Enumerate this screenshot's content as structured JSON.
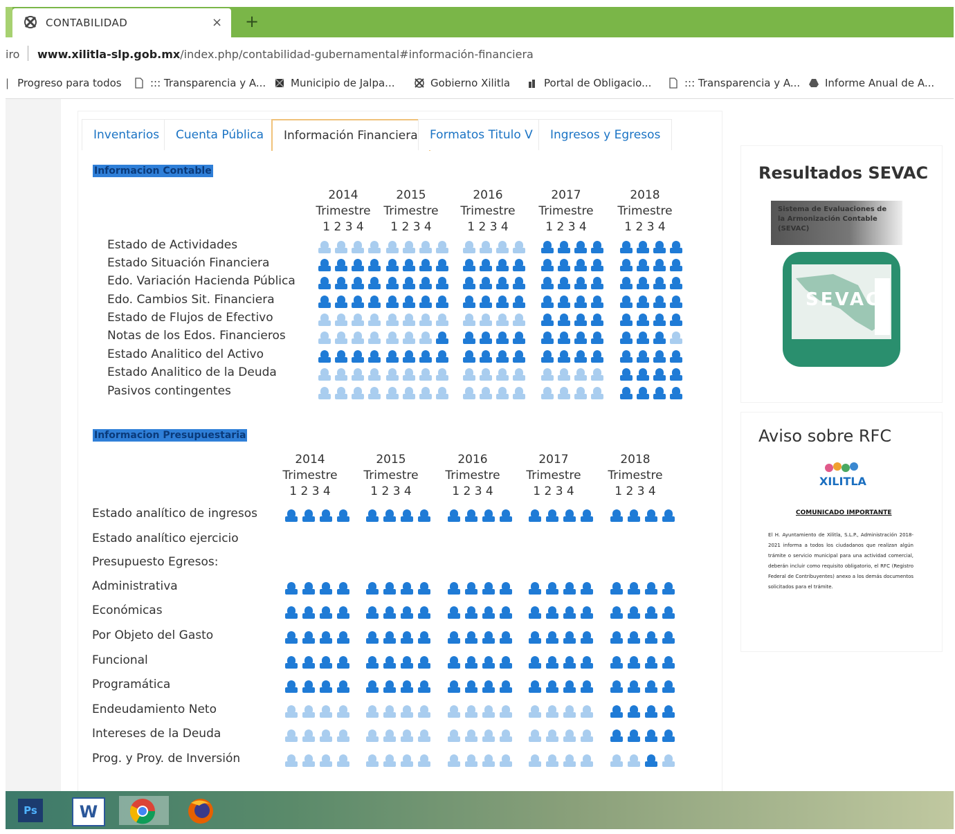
{
  "browser": {
    "tab_title": "CONTABILIDAD",
    "tab_close": "×",
    "new_tab": "+",
    "address_prefix": "iro",
    "url_host": "www.xilitla-slp.gob.mx",
    "url_path": "/index.php/contabilidad-gubernamental#información-financiera",
    "bookmarks": [
      {
        "label": "Progreso para todos",
        "icon": "none"
      },
      {
        "label": "::: Transparencia y A...",
        "icon": "page-icon"
      },
      {
        "label": "Municipio de Jalpa...",
        "icon": "seal-icon"
      },
      {
        "label": "Gobierno Xilitla",
        "icon": "seal-icon"
      },
      {
        "label": "Portal de Obligacio...",
        "icon": "portal-icon"
      },
      {
        "label": "::: Transparencia y A...",
        "icon": "page-icon"
      },
      {
        "label": "Informe Anual de A...",
        "icon": "drive-icon"
      }
    ]
  },
  "tabs": [
    "Inventarios",
    "Cuenta Pública",
    "Información Financiera",
    "Formatos Titulo V",
    "Ingresos y Egresos"
  ],
  "active_tab": "Información Financiera",
  "colors": {
    "icon_dark": "#1f7bd6",
    "icon_light": "#a9cdef",
    "accent": "#1a73c4"
  },
  "contable": {
    "title": "Informacion Contable",
    "years": [
      "2014",
      "2015",
      "2016",
      "2017",
      "2018"
    ],
    "trimestre_label": "Trimestre",
    "quarters": "1 2 3 4",
    "rows": [
      {
        "label": "Estado de Actividades",
        "status": [
          [
            0,
            0,
            0,
            0
          ],
          [
            0,
            0,
            0,
            0
          ],
          [
            0,
            0,
            0,
            0
          ],
          [
            1,
            1,
            1,
            1
          ],
          [
            1,
            1,
            1,
            1
          ]
        ]
      },
      {
        "label": "Estado Situación Financiera",
        "status": [
          [
            1,
            1,
            1,
            1
          ],
          [
            1,
            1,
            1,
            1
          ],
          [
            1,
            1,
            1,
            1
          ],
          [
            1,
            1,
            1,
            1
          ],
          [
            1,
            1,
            1,
            1
          ]
        ]
      },
      {
        "label": "Edo. Variación Hacienda Pública",
        "status": [
          [
            1,
            1,
            1,
            1
          ],
          [
            1,
            1,
            1,
            1
          ],
          [
            1,
            1,
            1,
            1
          ],
          [
            1,
            1,
            1,
            1
          ],
          [
            1,
            1,
            1,
            1
          ]
        ]
      },
      {
        "label": "Edo. Cambios Sit. Financiera",
        "status": [
          [
            1,
            1,
            1,
            1
          ],
          [
            1,
            1,
            1,
            1
          ],
          [
            1,
            1,
            1,
            1
          ],
          [
            1,
            1,
            1,
            1
          ],
          [
            1,
            1,
            1,
            1
          ]
        ]
      },
      {
        "label": "Estado de Flujos de Efectivo",
        "status": [
          [
            0,
            0,
            0,
            0
          ],
          [
            0,
            0,
            0,
            0
          ],
          [
            0,
            0,
            0,
            0
          ],
          [
            1,
            1,
            1,
            1
          ],
          [
            1,
            1,
            1,
            1
          ]
        ]
      },
      {
        "label": "Notas de los Edos. Financieros",
        "status": [
          [
            0,
            0,
            0,
            0
          ],
          [
            0,
            0,
            0,
            1
          ],
          [
            1,
            1,
            1,
            1
          ],
          [
            1,
            1,
            1,
            1
          ],
          [
            1,
            1,
            1,
            0
          ]
        ]
      },
      {
        "label": "Estado Analitico del Activo",
        "status": [
          [
            1,
            1,
            1,
            1
          ],
          [
            1,
            1,
            1,
            1
          ],
          [
            1,
            1,
            1,
            1
          ],
          [
            1,
            1,
            1,
            1
          ],
          [
            1,
            1,
            1,
            1
          ]
        ]
      },
      {
        "label": "Estado Analitico de la Deuda",
        "status": [
          [
            0,
            0,
            0,
            0
          ],
          [
            0,
            0,
            0,
            0
          ],
          [
            0,
            0,
            0,
            0
          ],
          [
            0,
            0,
            0,
            0
          ],
          [
            1,
            1,
            1,
            1
          ]
        ]
      },
      {
        "label": "Pasivos contingentes",
        "status": [
          [
            0,
            0,
            0,
            0
          ],
          [
            0,
            0,
            0,
            0
          ],
          [
            0,
            0,
            0,
            0
          ],
          [
            0,
            0,
            0,
            0
          ],
          [
            1,
            1,
            1,
            1
          ]
        ]
      }
    ]
  },
  "presupuestaria": {
    "title": "Informacion Presupuestaria",
    "years": [
      "2014",
      "2015",
      "2016",
      "2017",
      "2018"
    ],
    "trimestre_label": "Trimestre",
    "quarters": "1 2 3 4",
    "rows": [
      {
        "label": "Estado analítico de ingresos",
        "status": [
          [
            1,
            1,
            1,
            1
          ],
          [
            1,
            1,
            1,
            1
          ],
          [
            1,
            1,
            1,
            1
          ],
          [
            1,
            1,
            1,
            1
          ],
          [
            1,
            1,
            1,
            1
          ]
        ]
      },
      {
        "label": "Estado analítico ejercicio",
        "status": null
      },
      {
        "label": "Presupuesto Egresos:",
        "status": null
      },
      {
        "label": "Administrativa",
        "status": [
          [
            1,
            1,
            1,
            1
          ],
          [
            1,
            1,
            1,
            1
          ],
          [
            1,
            1,
            1,
            1
          ],
          [
            1,
            1,
            1,
            1
          ],
          [
            1,
            1,
            1,
            1
          ]
        ]
      },
      {
        "label": "Económicas",
        "status": [
          [
            1,
            1,
            1,
            1
          ],
          [
            1,
            1,
            1,
            1
          ],
          [
            1,
            1,
            1,
            1
          ],
          [
            1,
            1,
            1,
            1
          ],
          [
            1,
            1,
            1,
            1
          ]
        ]
      },
      {
        "label": "Por Objeto del Gasto",
        "status": [
          [
            1,
            1,
            1,
            1
          ],
          [
            1,
            1,
            1,
            1
          ],
          [
            1,
            1,
            1,
            1
          ],
          [
            1,
            1,
            1,
            1
          ],
          [
            1,
            1,
            1,
            1
          ]
        ]
      },
      {
        "label": "Funcional",
        "status": [
          [
            1,
            1,
            1,
            1
          ],
          [
            1,
            1,
            1,
            1
          ],
          [
            1,
            1,
            1,
            1
          ],
          [
            1,
            1,
            1,
            1
          ],
          [
            1,
            1,
            1,
            1
          ]
        ]
      },
      {
        "label": "Programática",
        "status": [
          [
            1,
            1,
            1,
            1
          ],
          [
            1,
            1,
            1,
            1
          ],
          [
            1,
            1,
            1,
            1
          ],
          [
            1,
            1,
            1,
            1
          ],
          [
            1,
            1,
            1,
            1
          ]
        ]
      },
      {
        "label": "Endeudamiento Neto",
        "status": [
          [
            0,
            0,
            0,
            0
          ],
          [
            0,
            0,
            0,
            0
          ],
          [
            0,
            0,
            0,
            0
          ],
          [
            0,
            0,
            0,
            0
          ],
          [
            1,
            1,
            1,
            1
          ]
        ]
      },
      {
        "label": "Intereses de la Deuda",
        "status": [
          [
            0,
            0,
            0,
            0
          ],
          [
            0,
            0,
            0,
            0
          ],
          [
            0,
            0,
            0,
            0
          ],
          [
            0,
            0,
            0,
            0
          ],
          [
            1,
            1,
            1,
            1
          ]
        ]
      },
      {
        "label": "Prog. y Proy. de Inversión",
        "status": [
          [
            0,
            0,
            0,
            0
          ],
          [
            0,
            0,
            0,
            0
          ],
          [
            0,
            0,
            0,
            0
          ],
          [
            0,
            0,
            0,
            0
          ],
          [
            0,
            0,
            1,
            0
          ]
        ]
      }
    ]
  },
  "sidebar": {
    "sevac_title": "Resultados SEVAC",
    "sevac_banner": "Sistema de Evaluaciones de la Armonización Contable (SEVAC)",
    "sevac_logo_text": "SEVAC",
    "rfc_title": "Aviso sobre RFC",
    "rfc_logo_text": "XILITLA",
    "rfc_heading": "COMUNICADO IMPORTANTE",
    "rfc_body": "El H. Ayuntamiento de Xilitla, S.L.P., Administración 2018-2021 informa a todos los ciudadanos que realizan algún trámite o servicio municipal para una actividad comercial, deberán incluir como requisito obligatorio, el RFC (Registro Federal de Contribuyentes) anexo a los demás documentos solicitados para el trámite."
  },
  "taskbar": {
    "apps": [
      {
        "label": "Ps",
        "icon": "photoshop-icon"
      },
      {
        "label": "W",
        "icon": "word-icon"
      },
      {
        "label": "",
        "icon": "chrome-icon"
      },
      {
        "label": "",
        "icon": "firefox-icon"
      }
    ]
  }
}
